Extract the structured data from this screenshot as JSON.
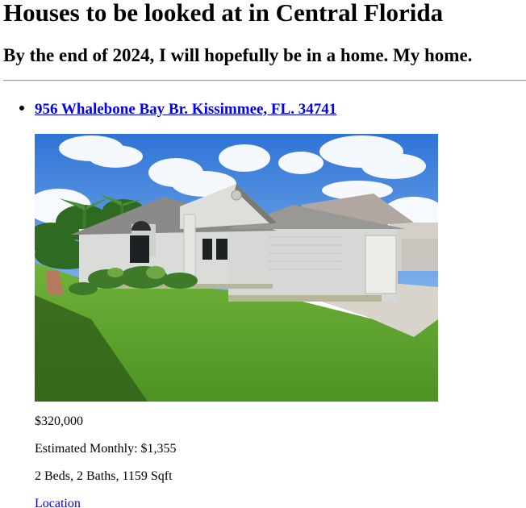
{
  "page": {
    "title": "Houses to be looked at in Central Florida",
    "subtitle": "By the end of 2024, I will hopefully be in a home. My home."
  },
  "listings": [
    {
      "address": "956 Whalebone Bay Br. Kissimmee, FL. 34741",
      "photo_icon": "house-photo",
      "price": "$320,000",
      "monthly": "Estimated Monthly: $1,355",
      "specs": "2 Beds, 2 Baths, 1159 Sqft",
      "location_label": "Location"
    }
  ],
  "colors": {
    "link": "#0000ee",
    "divider": "#9a9a9a",
    "sky": "#3b7fd9",
    "lawn": "#5fa32e",
    "house_wall": "#d9dcd8",
    "roof": "#8a8a88"
  }
}
